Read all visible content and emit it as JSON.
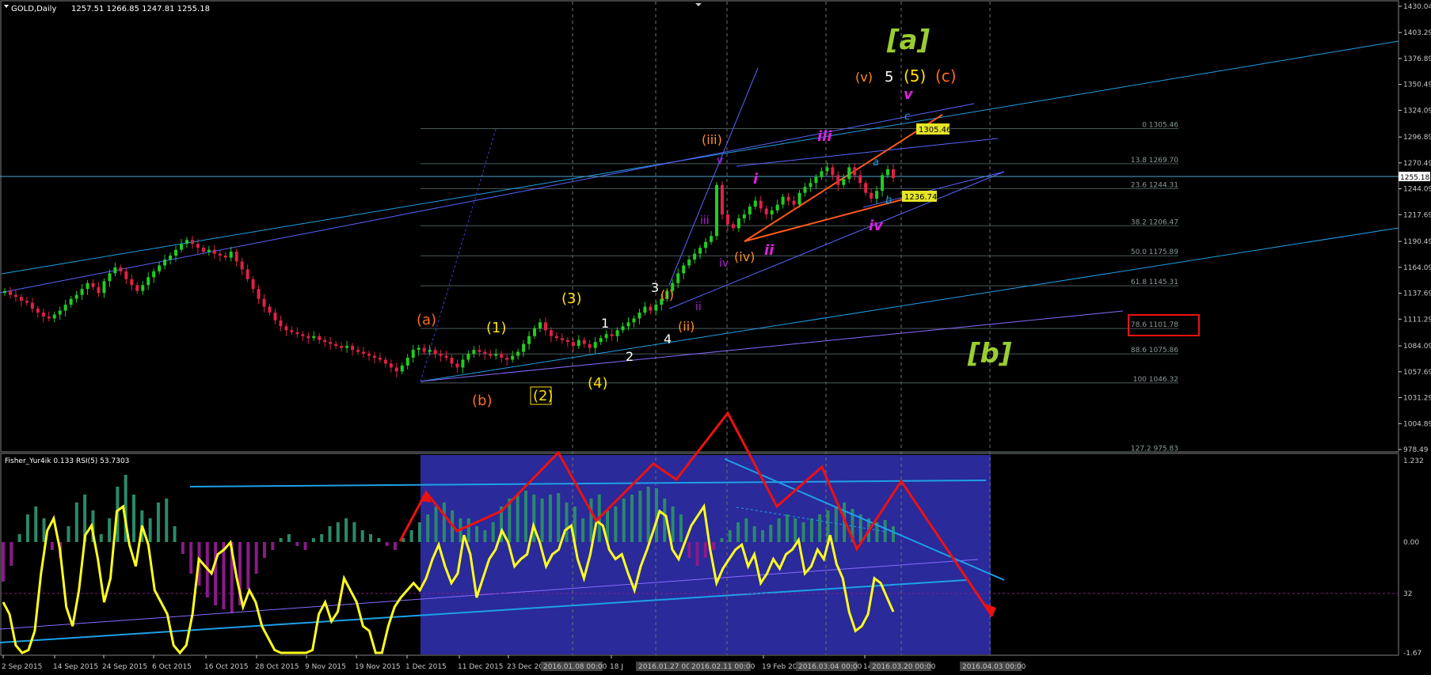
{
  "chart_data": [
    {
      "type": "candlestick",
      "symbol_label": "GOLD,Daily",
      "ohlc_text": "1257.51 1266.85 1247.81 1255.18",
      "current_price_label": "1255.18",
      "ylim": [
        978.49,
        1430.04
      ],
      "y_ticks": [
        "1430.04",
        "1403.29",
        "1376.89",
        "1350.49",
        "1324.09",
        "1296.89",
        "1270.49",
        "1244.09",
        "1217.69",
        "1190.49",
        "1164.09",
        "1137.69",
        "1111.29",
        "1084.09",
        "1057.69",
        "1031.29",
        "1004.89",
        "978.49"
      ],
      "closes": [
        1140,
        1136,
        1134,
        1130,
        1128,
        1122,
        1118,
        1114,
        1112,
        1116,
        1120,
        1126,
        1132,
        1136,
        1142,
        1148,
        1144,
        1138,
        1150,
        1158,
        1164,
        1160,
        1152,
        1146,
        1140,
        1146,
        1154,
        1160,
        1166,
        1172,
        1176,
        1182,
        1188,
        1192,
        1188,
        1184,
        1180,
        1182,
        1178,
        1176,
        1174,
        1180,
        1170,
        1162,
        1152,
        1142,
        1132,
        1124,
        1118,
        1110,
        1104,
        1100,
        1098,
        1096,
        1094,
        1092,
        1094,
        1090,
        1088,
        1086,
        1084,
        1082,
        1084,
        1080,
        1078,
        1076,
        1074,
        1072,
        1070,
        1066,
        1062,
        1058,
        1064,
        1072,
        1080,
        1082,
        1078,
        1080,
        1076,
        1074,
        1072,
        1066,
        1062,
        1070,
        1076,
        1080,
        1078,
        1076,
        1074,
        1076,
        1072,
        1070,
        1074,
        1078,
        1086,
        1094,
        1102,
        1108,
        1100,
        1094,
        1092,
        1090,
        1088,
        1084,
        1090,
        1086,
        1082,
        1088,
        1092,
        1096,
        1094,
        1100,
        1104,
        1108,
        1112,
        1118,
        1124,
        1120,
        1126,
        1132,
        1140,
        1148,
        1158,
        1166,
        1172,
        1178,
        1184,
        1190,
        1196,
        1248,
        1218,
        1208,
        1204,
        1214,
        1218,
        1226,
        1232,
        1224,
        1218,
        1222,
        1228,
        1236,
        1232,
        1228,
        1240,
        1246,
        1250,
        1256,
        1262,
        1266,
        1258,
        1248,
        1254,
        1266,
        1258,
        1250,
        1240,
        1234,
        1242,
        1258,
        1264,
        1255
      ],
      "fib_levels": [
        "0 1305.46",
        "13.8 1269.70",
        "23.6 1244.31",
        "38.2 1206.47",
        "50.0 1175.89",
        "61.8 1145.31",
        "78.6 1101.78",
        "88.6 1075.86",
        "100 1046.32",
        "127.2 975.83"
      ],
      "price_tags": [
        "1305.46",
        "1236.74"
      ],
      "wave_labels_orange": [
        "(a)",
        "(b)",
        "(c)",
        "(iii)",
        "(iv)",
        "(v)",
        "(i)",
        "(ii)"
      ],
      "wave_labels_yellow": [
        "(1)",
        "(2)",
        "(3)",
        "(4)",
        "(5)"
      ],
      "wave_labels_white": [
        "1",
        "2",
        "3",
        "4",
        "5"
      ],
      "wave_labels_magenta": [
        "i",
        "ii",
        "iii",
        "iv",
        "v"
      ],
      "wave_labels_violet": [
        "iii",
        "iv",
        "v",
        "ii"
      ],
      "wave_labels_blue": [
        "a",
        "b",
        "c"
      ],
      "major_labels": [
        "[a]",
        "[b]"
      ]
    },
    {
      "type": "line",
      "indicator_label": "Fisher_Yur4ik 0.133  RSI(5) 53.7303",
      "y_ticks": [
        "1.232",
        "0.00",
        "32",
        "-1.67"
      ],
      "rsi": [
        40,
        35,
        22,
        18,
        20,
        28,
        52,
        70,
        75,
        62,
        38,
        30,
        45,
        68,
        72,
        58,
        40,
        50,
        78,
        80,
        64,
        55,
        72,
        64,
        45,
        40,
        35,
        22,
        18,
        22,
        35,
        58,
        55,
        52,
        60,
        62,
        65,
        50,
        38,
        45,
        40,
        30,
        25,
        20,
        15,
        18,
        12,
        10,
        12,
        20,
        35,
        40,
        32,
        36,
        50,
        45,
        40,
        30,
        28,
        18,
        12,
        30,
        38,
        42,
        45,
        48,
        45,
        50,
        58,
        64,
        55,
        48,
        52,
        68,
        60,
        42,
        50,
        58,
        62,
        70,
        65,
        55,
        58,
        60,
        72,
        65,
        55,
        60,
        62,
        70,
        72,
        58,
        50,
        60,
        74,
        72,
        62,
        58,
        60,
        52,
        45,
        55,
        62,
        70,
        78,
        76,
        62,
        58,
        65,
        72,
        76,
        80,
        62,
        48,
        54,
        58,
        62,
        64,
        55,
        60,
        48,
        52,
        58,
        54,
        60,
        62,
        66,
        52,
        55,
        62,
        58,
        68,
        56,
        50,
        36,
        28,
        30,
        35,
        50,
        48,
        42,
        36
      ],
      "histogram": [
        -0.5,
        -0.3,
        0.1,
        0.35,
        0.45,
        0.3,
        -0.1,
        -0.2,
        0.2,
        0.5,
        0.6,
        0.4,
        0.1,
        0.3,
        0.7,
        0.85,
        0.6,
        0.4,
        0.3,
        0.5,
        0.55,
        0.2,
        -0.15,
        -0.4,
        -0.55,
        -0.7,
        -0.8,
        -0.85,
        -0.9,
        -0.8,
        -0.6,
        -0.4,
        -0.2,
        -0.1,
        0.05,
        0.1,
        -0.05,
        -0.1,
        0.05,
        0.1,
        0.2,
        0.25,
        0.3,
        0.25,
        0.15,
        0.1,
        0.05,
        -0.05,
        -0.1,
        0.05,
        0.15,
        0.25,
        0.35,
        0.45,
        0.5,
        0.4,
        0.3,
        0.3,
        0.2,
        0.15,
        0.25,
        0.45,
        0.55,
        0.6,
        0.65,
        0.6,
        0.55,
        0.6,
        0.62,
        0.5,
        0.45,
        0.3,
        0.55,
        0.6,
        0.4,
        0.45,
        0.55,
        0.6,
        0.65,
        0.7,
        0.68,
        0.55,
        0.45,
        0.35,
        -0.2,
        -0.3,
        -0.2,
        -0.1,
        0.05,
        0.15,
        0.25,
        0.3,
        0.2,
        0.15,
        0.22,
        0.3,
        0.35,
        0.3,
        0.25,
        0.3,
        0.35,
        0.4,
        0.45,
        0.5,
        0.42,
        0.35,
        0.3,
        0.25,
        0.28,
        0.2
      ],
      "signal_band_values": [
        "1.232"
      ]
    }
  ],
  "x_axis_dates": [
    "2 Sep 2015",
    "14 Sep 2015",
    "24 Sep 2015",
    "6 Oct 2015",
    "16 Oct 2015",
    "28 Oct 2015",
    "9 Nov 2015",
    "19 Nov 2015",
    "1 Dec 2015",
    "11 Dec 2015",
    "23 Dec 20",
    "18 J",
    "19 Feb 20",
    "14"
  ],
  "x_axis_boxed_dates": [
    "2016.01.08 00:00",
    "2016.01.27 00:00",
    "2016.02.11 00:00",
    "2016.03.04 00:00",
    "2016.03.20 00:00",
    "2016.04.03 00:00"
  ],
  "colors": {
    "background": "#000000",
    "bull": "#22cc22",
    "bear": "#dd2244",
    "axis_text": "#c8c8c8",
    "trendline_cyan": "#1ea0e8",
    "trendline_blue": "#5a64ff",
    "fib_grey": "#4a5a5a",
    "rsi": "#ffff20",
    "projection": "#ee1111",
    "highlight_band": "#2a2a9a",
    "hist_pos": "#2a8a6a",
    "hist_neg": "#8a1a8a",
    "orange": "#ff8c1a",
    "yellow": "#ffe100",
    "magenta": "#e020e0",
    "green_label": "#9acd32"
  }
}
